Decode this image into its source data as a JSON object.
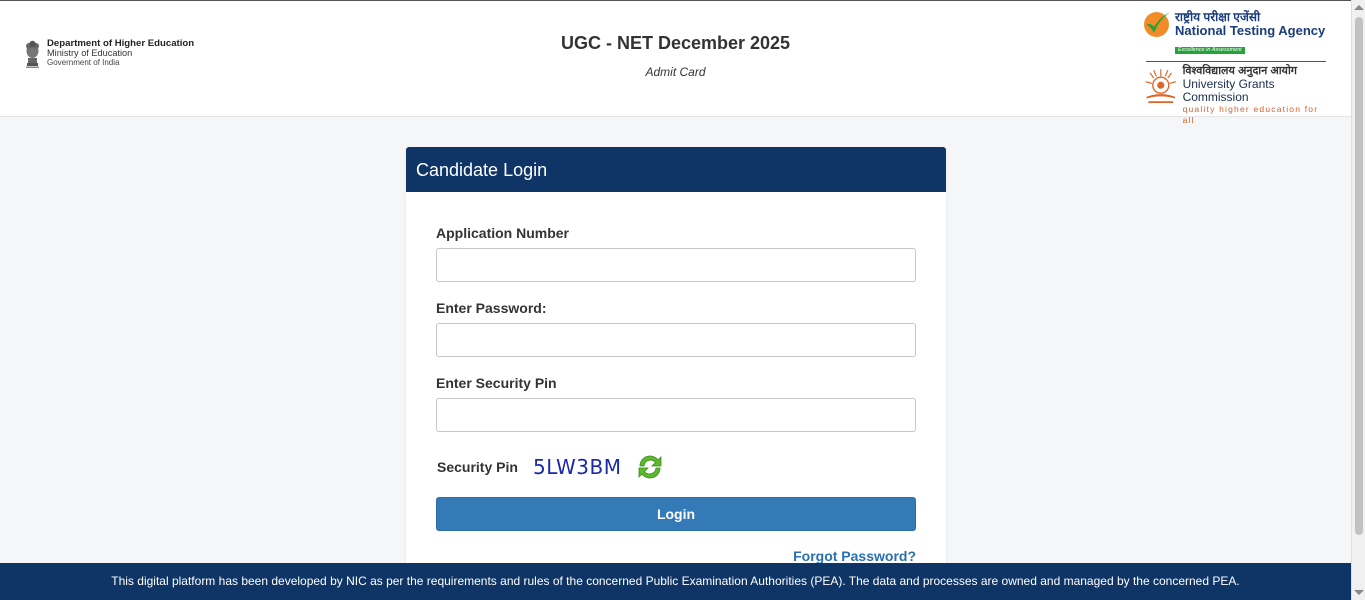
{
  "header": {
    "dept": {
      "title": "Department of Higher Education",
      "ministry": "Ministry of Education",
      "government": "Government of India"
    },
    "title": "UGC - NET December 2025",
    "subtitle": "Admit Card",
    "nta": {
      "hindi": "राष्ट्रीय परीक्षा एजेंसी",
      "name": "National Testing Agency",
      "tagline": "Excellence in Assessment"
    },
    "ugc": {
      "hindi": "विश्वविद्यालय अनुदान आयोग",
      "name": "University Grants Commission",
      "quality": "quality higher education for all"
    }
  },
  "login": {
    "heading": "Candidate Login",
    "application_label": "Application Number",
    "application_value": "",
    "password_label": "Enter Password:",
    "password_value": "",
    "security_label": "Enter Security Pin",
    "security_value": "",
    "captcha_label": "Security Pin",
    "captcha_value": "5LW3BM",
    "login_button": "Login",
    "forgot_link": "Forgot Password?"
  },
  "footer": {
    "text": "This digital platform has been developed by NIC as per the requirements and rules of the concerned Public Examination Authorities (PEA). The data and processes are owned and managed by the concerned PEA."
  },
  "icons": {
    "emblem": "national-emblem-icon",
    "nta_logo": "nta-check-icon",
    "ugc_logo": "ugc-sun-icon",
    "refresh": "refresh-icon"
  },
  "colors": {
    "primary_navy": "#0e3566",
    "button_blue": "#337ab7",
    "captcha_blue": "#1d2aa8",
    "link_blue": "#2a6fb0",
    "nta_green": "#25a23a",
    "nta_orange": "#f28c28"
  }
}
